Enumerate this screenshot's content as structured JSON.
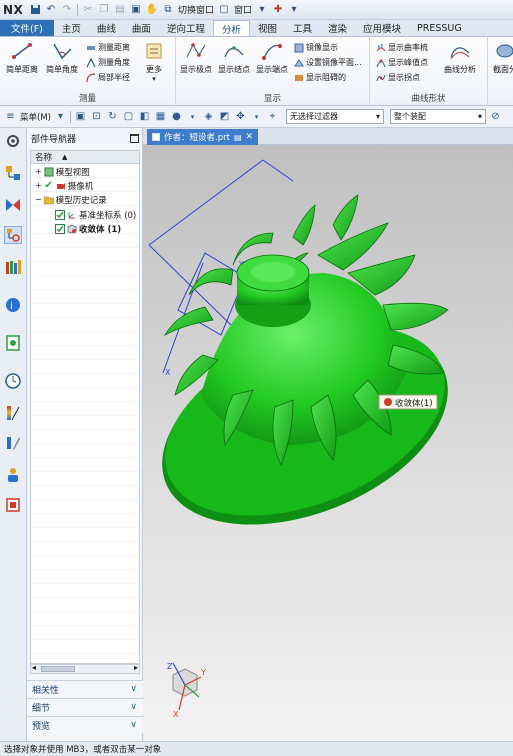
{
  "app": {
    "logo": "NX"
  },
  "quick_access": {
    "switch_window": "切换窗口",
    "window": "窗口"
  },
  "tabs": [
    "文件(F)",
    "主页",
    "曲线",
    "曲面",
    "逆向工程",
    "分析",
    "视图",
    "工具",
    "渲染",
    "应用模块",
    "PRESSUG"
  ],
  "active_tab": "分析",
  "ribbon": {
    "measure": {
      "label": "测量",
      "simple_distance": "简单距离",
      "simple_angle": "简单角度",
      "measure_distance": "测量距离",
      "measure_angle": "测量角度",
      "local_radius": "局部半径",
      "more": "更多"
    },
    "display": {
      "label": "显示",
      "show_poles": "显示极点",
      "show_knots": "显示结点",
      "show_endpoints": "显示端点",
      "mirror_display": "镜像显示",
      "set_mirror_plane": "设置镜像平面...",
      "show_obstructing": "显示阻碍的"
    },
    "curve_shape": {
      "label": "曲线形状",
      "show_curvature_comb": "显示曲率梳",
      "show_peak_points": "显示峰值点",
      "show_inflections": "显示拐点",
      "curve_analysis": "曲线分析",
      "section_analysis": "截面分"
    }
  },
  "toolbar": {
    "menu": "菜单(M)",
    "filter": "无选择过滤器",
    "assembly": "整个装配"
  },
  "navigator": {
    "title": "部件导航器",
    "column_name": "名称",
    "tree": {
      "model_views": "模型视图",
      "cameras": "摄像机",
      "model_history": "模型历史记录",
      "datum_csys": "基准坐标系 (0)",
      "body": "收敛体 (1)"
    },
    "sections": [
      "相关性",
      "细节",
      "预览"
    ]
  },
  "document_tab": "作者：短设者.prt",
  "viewport": {
    "tooltip": "收敛体(1)",
    "triad": {
      "x": "X",
      "y": "Y",
      "z": "Z"
    }
  },
  "status_bar": "选择对象并使用 MB3，或者双击某一对象",
  "colors": {
    "accent": "#2f6fb7",
    "model_green": "#1fd11f",
    "model_dark": "#0e8e12"
  }
}
